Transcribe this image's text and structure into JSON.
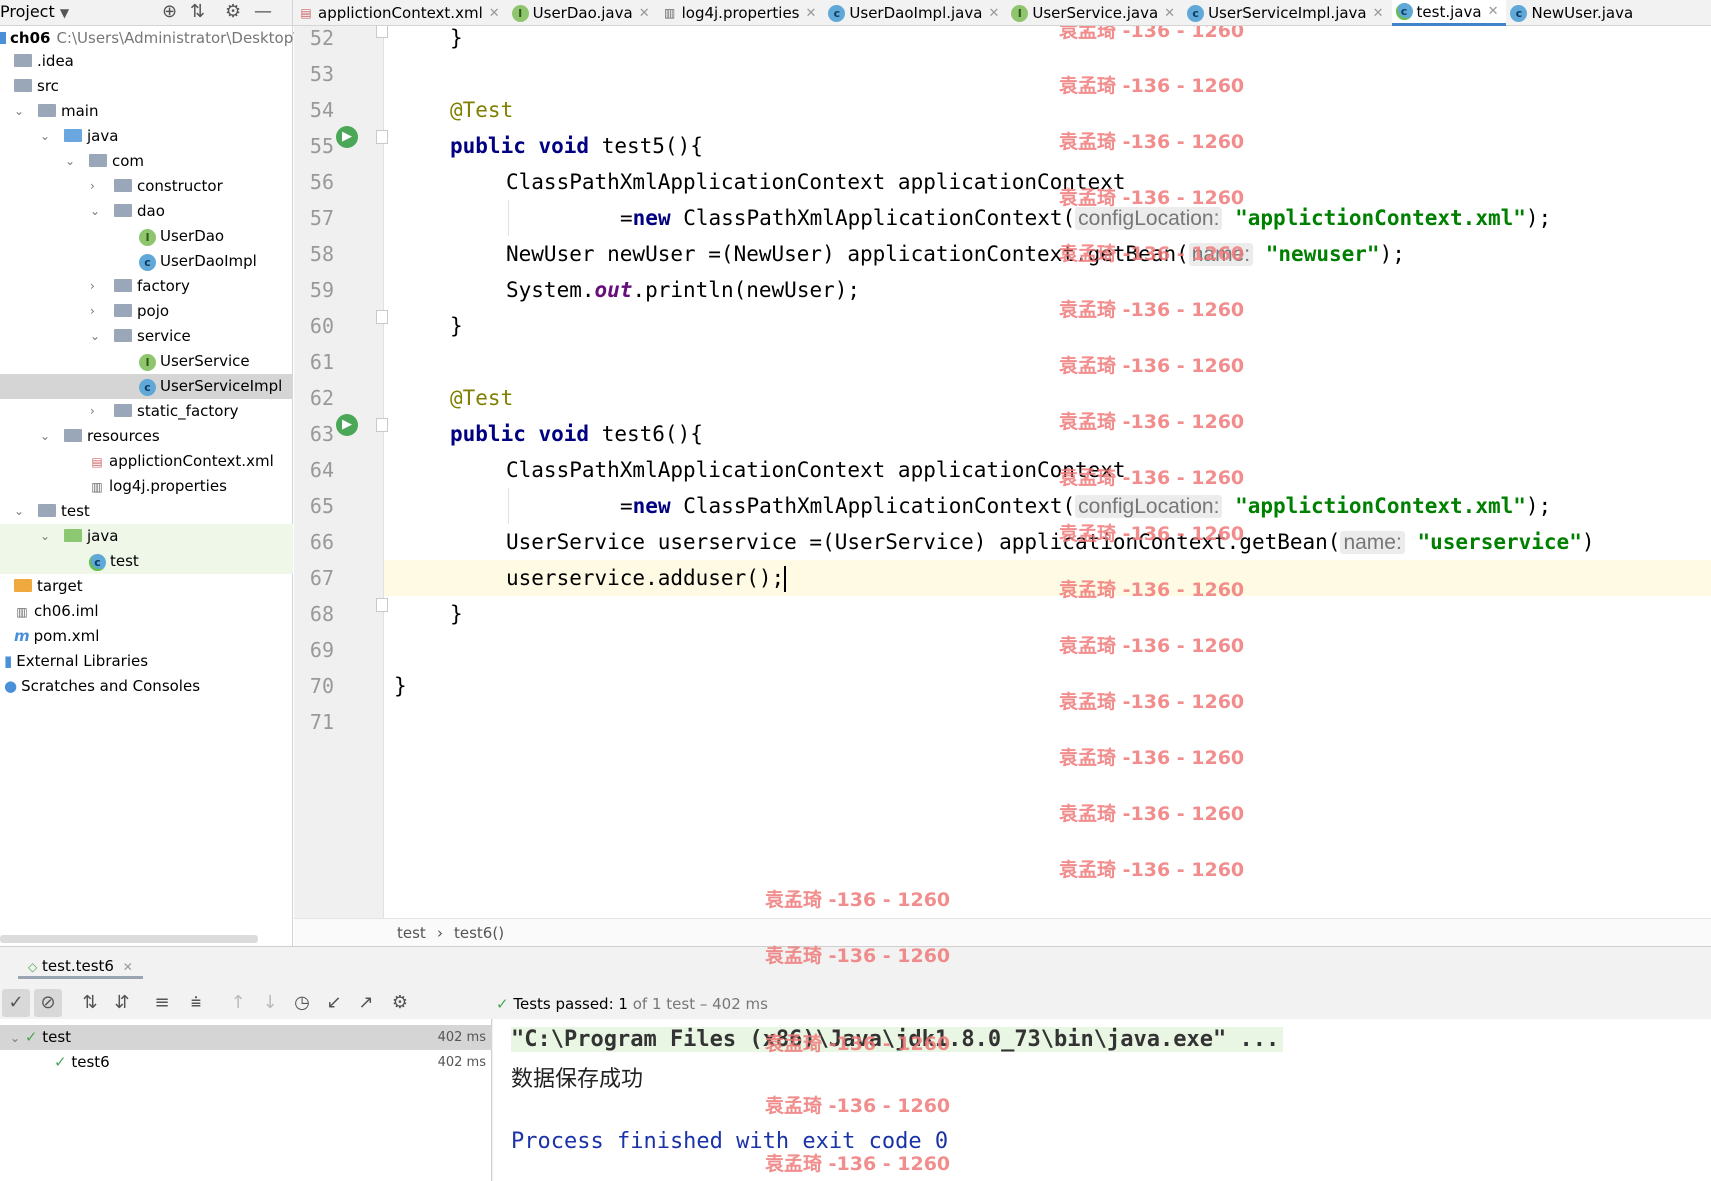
{
  "project_bar": {
    "title": "Project"
  },
  "tabs": [
    {
      "label": "applictionContext.xml",
      "icon": "xml-file-icon"
    },
    {
      "label": "UserDao.java",
      "icon": "interface-icon"
    },
    {
      "label": "log4j.properties",
      "icon": "properties-file-icon"
    },
    {
      "label": "UserDaoImpl.java",
      "icon": "class-icon"
    },
    {
      "label": "UserService.java",
      "icon": "interface-icon"
    },
    {
      "label": "UserServiceImpl.java",
      "icon": "class-icon"
    },
    {
      "label": "test.java",
      "icon": "test-class-icon",
      "active": true
    },
    {
      "label": "NewUser.java",
      "icon": "class-icon"
    }
  ],
  "tree": {
    "root_name": "ch06",
    "root_path": "C:\\Users\\Administrator\\Desktop\\",
    "items": [
      {
        "label": ".idea"
      },
      {
        "label": "src"
      },
      {
        "label": "main"
      },
      {
        "label": "java"
      },
      {
        "label": "com"
      },
      {
        "label": "constructor"
      },
      {
        "label": "dao"
      },
      {
        "label": "UserDao"
      },
      {
        "label": "UserDaoImpl"
      },
      {
        "label": "factory"
      },
      {
        "label": "pojo"
      },
      {
        "label": "service"
      },
      {
        "label": "UserService"
      },
      {
        "label": "UserServiceImpl"
      },
      {
        "label": "static_factory"
      },
      {
        "label": "resources"
      },
      {
        "label": "applictionContext.xml"
      },
      {
        "label": "log4j.properties"
      },
      {
        "label": "test"
      },
      {
        "label": "java"
      },
      {
        "label": "test"
      },
      {
        "label": "target"
      },
      {
        "label": "ch06.iml"
      },
      {
        "label": "pom.xml"
      },
      {
        "label": "External Libraries"
      },
      {
        "label": "Scratches and Consoles"
      }
    ]
  },
  "editor": {
    "line_numbers": [
      "52",
      "53",
      "54",
      "55",
      "56",
      "57",
      "58",
      "59",
      "60",
      "61",
      "62",
      "63",
      "64",
      "65",
      "66",
      "67",
      "68",
      "69",
      "70",
      "71"
    ],
    "code": {
      "l52": "}",
      "l54": "@Test",
      "l55_kw": "public void",
      "l55_rest": " test5(){",
      "l56": "ClassPathXmlApplicationContext applicationContext",
      "l57_a": "=",
      "l57_kw": "new",
      "l57_b": " ClassPathXmlApplicationContext(",
      "l57_hint": "configLocation:",
      "l57_str": "\"applictionContext.xml\"",
      "l57_end": ");",
      "l58_a": "NewUser newUser =(NewUser) applicationContext.getBean(",
      "l58_hint": "name:",
      "l58_str": "\"newuser\"",
      "l58_end": ");",
      "l59_a": "System.",
      "l59_out": "out",
      "l59_b": ".println(newUser);",
      "l60": "}",
      "l62": "@Test",
      "l63_kw": "public void",
      "l63_rest": " test6(){",
      "l64": "ClassPathXmlApplicationContext applicationContext",
      "l65_a": "=",
      "l65_kw": "new",
      "l65_b": " ClassPathXmlApplicationContext(",
      "l65_hint": "configLocation:",
      "l65_str": "\"applictionContext.xml\"",
      "l65_end": ");",
      "l66_a": "UserService userservice =(UserService) applicationContext.getBean(",
      "l66_hint": "name:",
      "l66_str": "\"userservice\"",
      "l66_end": ")",
      "l67": "userservice.adduser();",
      "l68": "}",
      "l70": "}"
    },
    "watermark": "袁孟琦 -136 - 1260"
  },
  "breadcrumb": {
    "class": "test",
    "sep": "›",
    "method": "test6()"
  },
  "run_panel": {
    "tab_label": "test.test6",
    "status_prefix": "Tests passed:",
    "status_count": "1",
    "status_rest": "of 1 test – 402 ms",
    "tree": [
      {
        "label": "test",
        "time": "402 ms"
      },
      {
        "label": "test6",
        "time": "402 ms"
      }
    ],
    "console": {
      "cmd": "\"C:\\Program Files (x86)\\Java\\jdk1.8.0_73\\bin\\java.exe\" ...",
      "output": "数据保存成功",
      "exit": "Process finished with exit code 0"
    }
  },
  "colors": {
    "keyword": "#000080",
    "string": "#008000",
    "annotation": "#808000",
    "watermark": "#f07a7a",
    "accent": "#4083c9"
  }
}
